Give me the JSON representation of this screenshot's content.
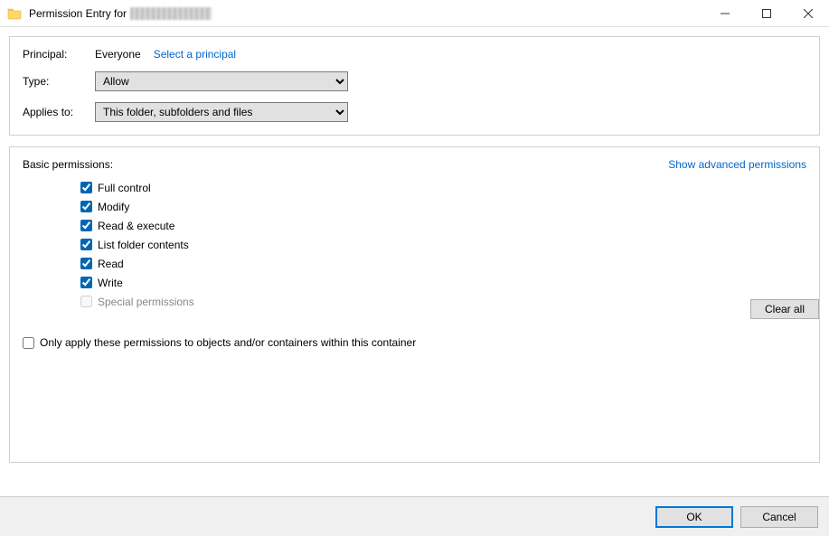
{
  "titlebar": {
    "title_prefix": "Permission Entry for"
  },
  "principal": {
    "label": "Principal:",
    "value": "Everyone",
    "select_link": "Select a principal"
  },
  "type": {
    "label": "Type:",
    "value": "Allow"
  },
  "applies_to": {
    "label": "Applies to:",
    "value": "This folder, subfolders and files"
  },
  "permissions": {
    "title": "Basic permissions:",
    "advanced_link": "Show advanced permissions",
    "items": [
      {
        "label": "Full control",
        "checked": true,
        "enabled": true
      },
      {
        "label": "Modify",
        "checked": true,
        "enabled": true
      },
      {
        "label": "Read & execute",
        "checked": true,
        "enabled": true
      },
      {
        "label": "List folder contents",
        "checked": true,
        "enabled": true
      },
      {
        "label": "Read",
        "checked": true,
        "enabled": true
      },
      {
        "label": "Write",
        "checked": true,
        "enabled": true
      },
      {
        "label": "Special permissions",
        "checked": false,
        "enabled": false
      }
    ]
  },
  "only_apply": {
    "label": "Only apply these permissions to objects and/or containers within this container",
    "checked": false
  },
  "buttons": {
    "clear_all": "Clear all",
    "ok": "OK",
    "cancel": "Cancel"
  }
}
